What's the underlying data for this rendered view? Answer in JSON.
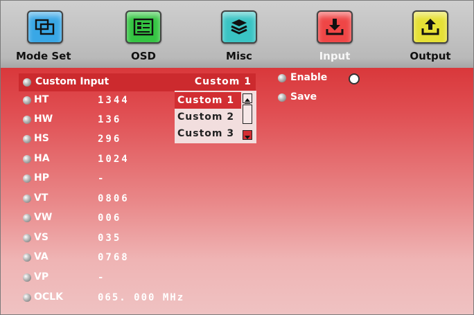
{
  "tabs": [
    {
      "label": "Mode Set",
      "icon": "windows-icon",
      "color": "#39a7e6",
      "selected": false
    },
    {
      "label": "OSD",
      "icon": "osd-menu-icon",
      "color": "#34c442",
      "selected": false
    },
    {
      "label": "Misc",
      "icon": "stack-icon",
      "color": "#3ac4c4",
      "selected": false
    },
    {
      "label": "Input",
      "icon": "input-download-icon",
      "color": "#ef4646",
      "selected": true
    },
    {
      "label": "Output",
      "icon": "output-upload-icon",
      "color": "#e6e035",
      "selected": false
    }
  ],
  "header": {
    "label": "Custom Input",
    "value": "Custom 1"
  },
  "params": [
    {
      "name": "HT",
      "value": "1344"
    },
    {
      "name": "HW",
      "value": "136"
    },
    {
      "name": "HS",
      "value": "296"
    },
    {
      "name": "HA",
      "value": "1024"
    },
    {
      "name": "HP",
      "value": "-"
    },
    {
      "name": "VT",
      "value": "0806"
    },
    {
      "name": "VW",
      "value": "006"
    },
    {
      "name": "VS",
      "value": "035"
    },
    {
      "name": "VA",
      "value": "0768"
    },
    {
      "name": "VP",
      "value": "-"
    },
    {
      "name": "OCLK",
      "value": "065. 000 MHz"
    }
  ],
  "dropdown": {
    "options": [
      "Custom 1",
      "Custom 2",
      "Custom 3"
    ],
    "selected_index": 0
  },
  "right": {
    "enable_label": "Enable",
    "save_label": "Save"
  },
  "colors": {
    "panel_top": "#d9383b",
    "panel_bottom": "#efc2c2",
    "highlight": "#cc2a2e",
    "dropdown_bg": "#f2dede"
  }
}
